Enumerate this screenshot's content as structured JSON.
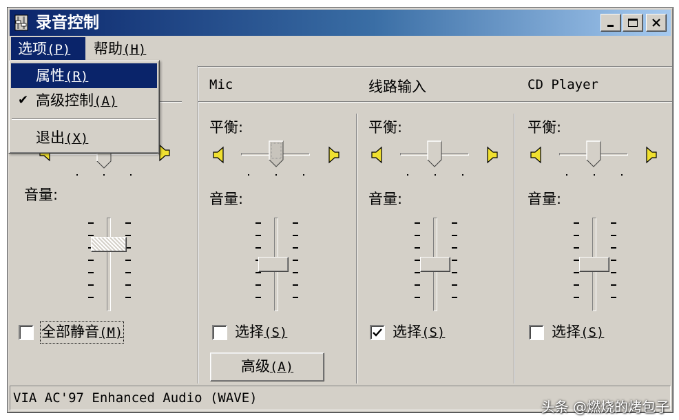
{
  "window": {
    "title": "录音控制",
    "buttons": {
      "minimize": "minimize-icon",
      "maximize": "maximize-icon",
      "close": "close-icon"
    }
  },
  "menubar": {
    "items": [
      {
        "label": "选项",
        "mnemonic": "(P)",
        "active": true
      },
      {
        "label": "帮助",
        "mnemonic": "(H)",
        "active": false
      }
    ]
  },
  "dropdown": {
    "items": [
      {
        "label": "属性",
        "mnemonic": "(R)",
        "highlighted": true,
        "checked": false
      },
      {
        "label": "高级控制",
        "mnemonic": "(A)",
        "highlighted": false,
        "checked": true
      },
      {
        "label": "退出",
        "mnemonic": "(X)",
        "highlighted": false,
        "checked": false
      }
    ]
  },
  "channels": [
    {
      "name": "",
      "balance_label": "",
      "balance": 0.5,
      "volume_label": "音量:",
      "volume": 0.7,
      "checkbox_label": "全部静音",
      "checkbox_mnemonic": "(M)",
      "checked": false
    },
    {
      "name": "Mic",
      "balance_label": "平衡:",
      "balance": 0.5,
      "volume_label": "音量:",
      "volume": 0.5,
      "checkbox_label": "选择",
      "checkbox_mnemonic": "(S)",
      "checked": false,
      "button_label": "高级",
      "button_mnemonic": "(A)"
    },
    {
      "name": "线路输入",
      "balance_label": "平衡:",
      "balance": 0.5,
      "volume_label": "音量:",
      "volume": 0.5,
      "checkbox_label": "选择",
      "checkbox_mnemonic": "(S)",
      "checked": true
    },
    {
      "name": "CD Player",
      "balance_label": "平衡:",
      "balance": 0.5,
      "volume_label": "音量:",
      "volume": 0.5,
      "checkbox_label": "选择",
      "checkbox_mnemonic": "(S)",
      "checked": false
    }
  ],
  "statusbar": {
    "text": "VIA AC'97 Enhanced Audio (WAVE)"
  },
  "watermark": {
    "text": "头条 @燃烧的烤包子"
  },
  "colors": {
    "title_start": "#0a246a",
    "title_end": "#a6caf0",
    "face": "#d4d0c8",
    "highlight": "#0a246a"
  }
}
